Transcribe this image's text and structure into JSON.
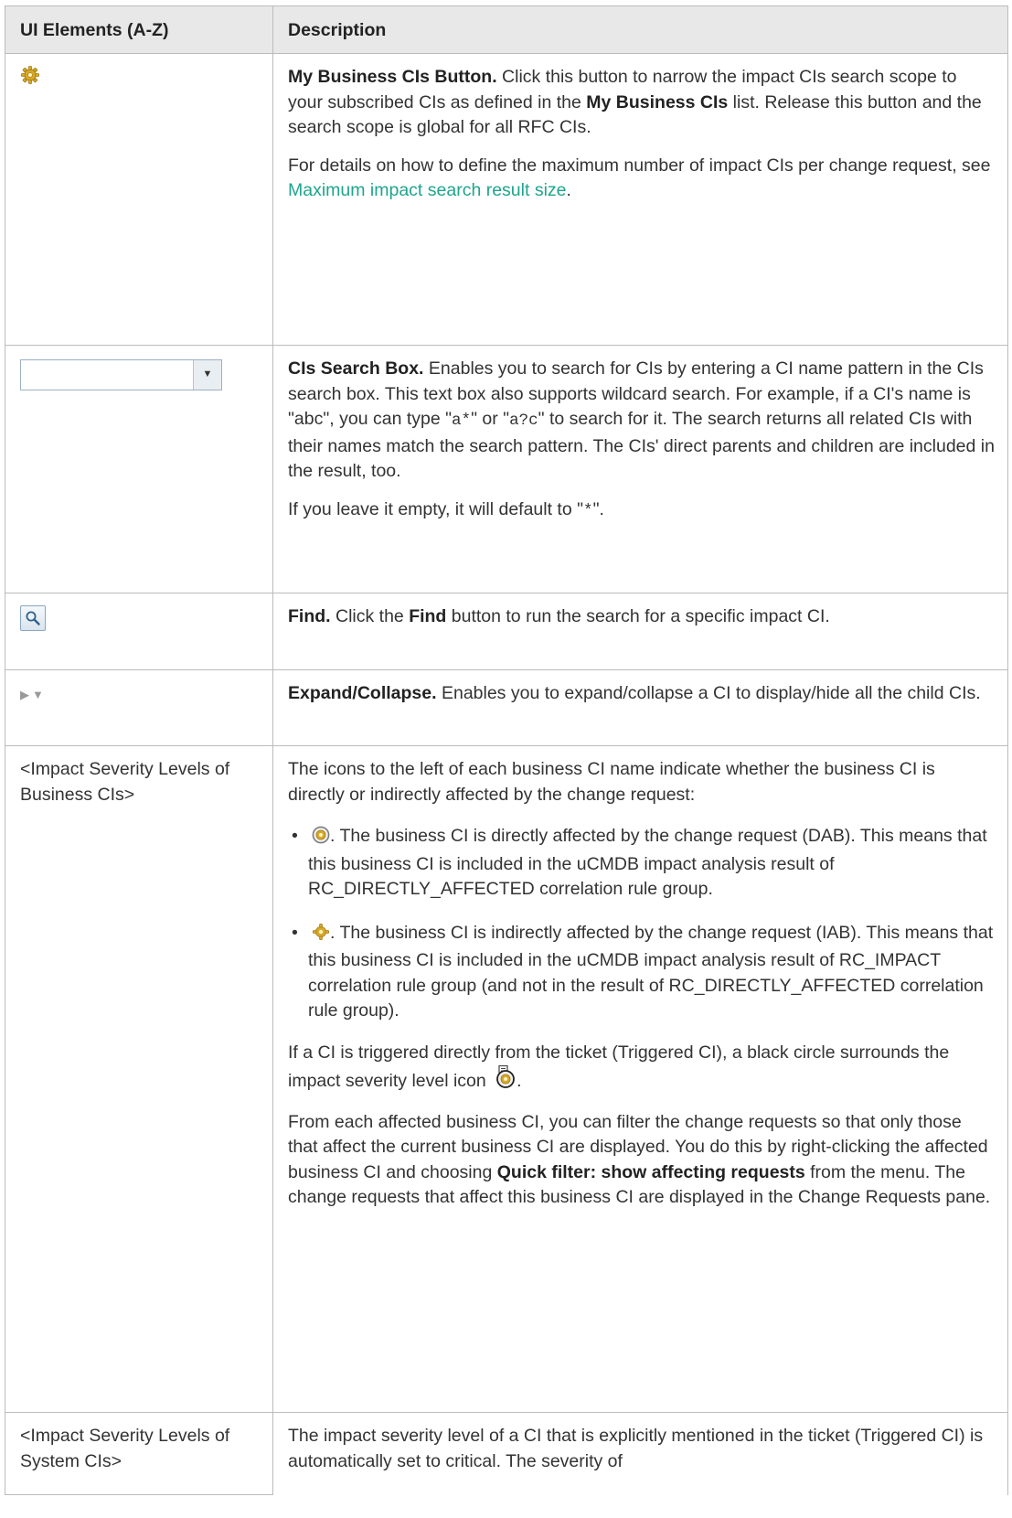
{
  "table": {
    "header": {
      "col1": "UI Elements (A-Z)",
      "col2": "Description"
    },
    "rows": {
      "my_business": {
        "icon": "gear-icon",
        "title": "My Business CIs Button.",
        "p1_a": " Click this button to narrow the impact CIs search scope to your subscribed CIs as defined in the ",
        "p1_b": "My Business CIs",
        "p1_c": " list. Release this button and the search scope is global for all RFC CIs.",
        "p2_a": "For details on how to define the maximum number of impact CIs per change request, see ",
        "p2_link": "Maximum impact search result size",
        "p2_b": "."
      },
      "search_box": {
        "icon": "combo-box",
        "title": "CIs Search Box.",
        "p1_a": " Enables you to search for CIs by entering a CI name pattern in the CIs search box. This text box also supports wildcard search. For example, if a CI's name is \"abc\", you can type \"",
        "code1": "a*",
        "p1_b": "\" or \"",
        "code2": "a?c",
        "p1_c": "\" to search for it. The search returns all related CIs with their names match the search pattern. The CIs' direct parents and children are included in the result, too.",
        "p2_a": "If you leave it empty, it will default to \"",
        "code3": "*",
        "p2_b": "\"."
      },
      "find": {
        "icon": "search-icon",
        "title": "Find.",
        "p1_a": " Click the ",
        "p1_bold": "Find",
        "p1_b": " button to run the search for a specific impact CI."
      },
      "expand": {
        "icon": "expand-collapse-icon",
        "title": "Expand/Collapse.",
        "p1": " Enables you to expand/collapse a CI to display/hide all the child CIs."
      },
      "business_severity": {
        "label": "<Impact Severity Levels of Business CIs>",
        "intro": "The icons to the left of each business CI name indicate whether the business CI is directly or indirectly affected by the change request:",
        "bullet1": ". The business CI is directly affected by the change request (DAB). This means that this business CI is included in the uCMDB impact analysis result of RC_DIRECTLY_AFFECTED correlation rule group.",
        "bullet2": ". The business CI is indirectly affected by the change request (IAB). This means that this business CI is included in the uCMDB impact analysis result of RC_IMPACT correlation rule group (and not in the result of RC_DIRECTLY_AFFECTED correlation rule group).",
        "triggered": "If a CI is triggered directly from the ticket (Triggered CI), a black circle surrounds the impact severity level icon ",
        "triggered_end": ".",
        "filter_a": "From each affected business CI, you can filter the change requests so that only those that affect the current business CI are displayed. You do this by right-clicking the affected business CI and choosing ",
        "filter_bold": "Quick filter: show affecting requests",
        "filter_b": " from the menu. The change requests that affect this business CI are displayed in the Change Requests pane."
      },
      "system_severity": {
        "label": "<Impact Severity Levels of System CIs>",
        "text": "The impact severity level of a CI that is explicitly mentioned in the ticket (Triggered CI) is automatically set to critical. The severity of"
      }
    }
  },
  "colors": {
    "link": "#1ea58c",
    "header_bg": "#e8e8e8",
    "border": "#bcbcbc"
  }
}
